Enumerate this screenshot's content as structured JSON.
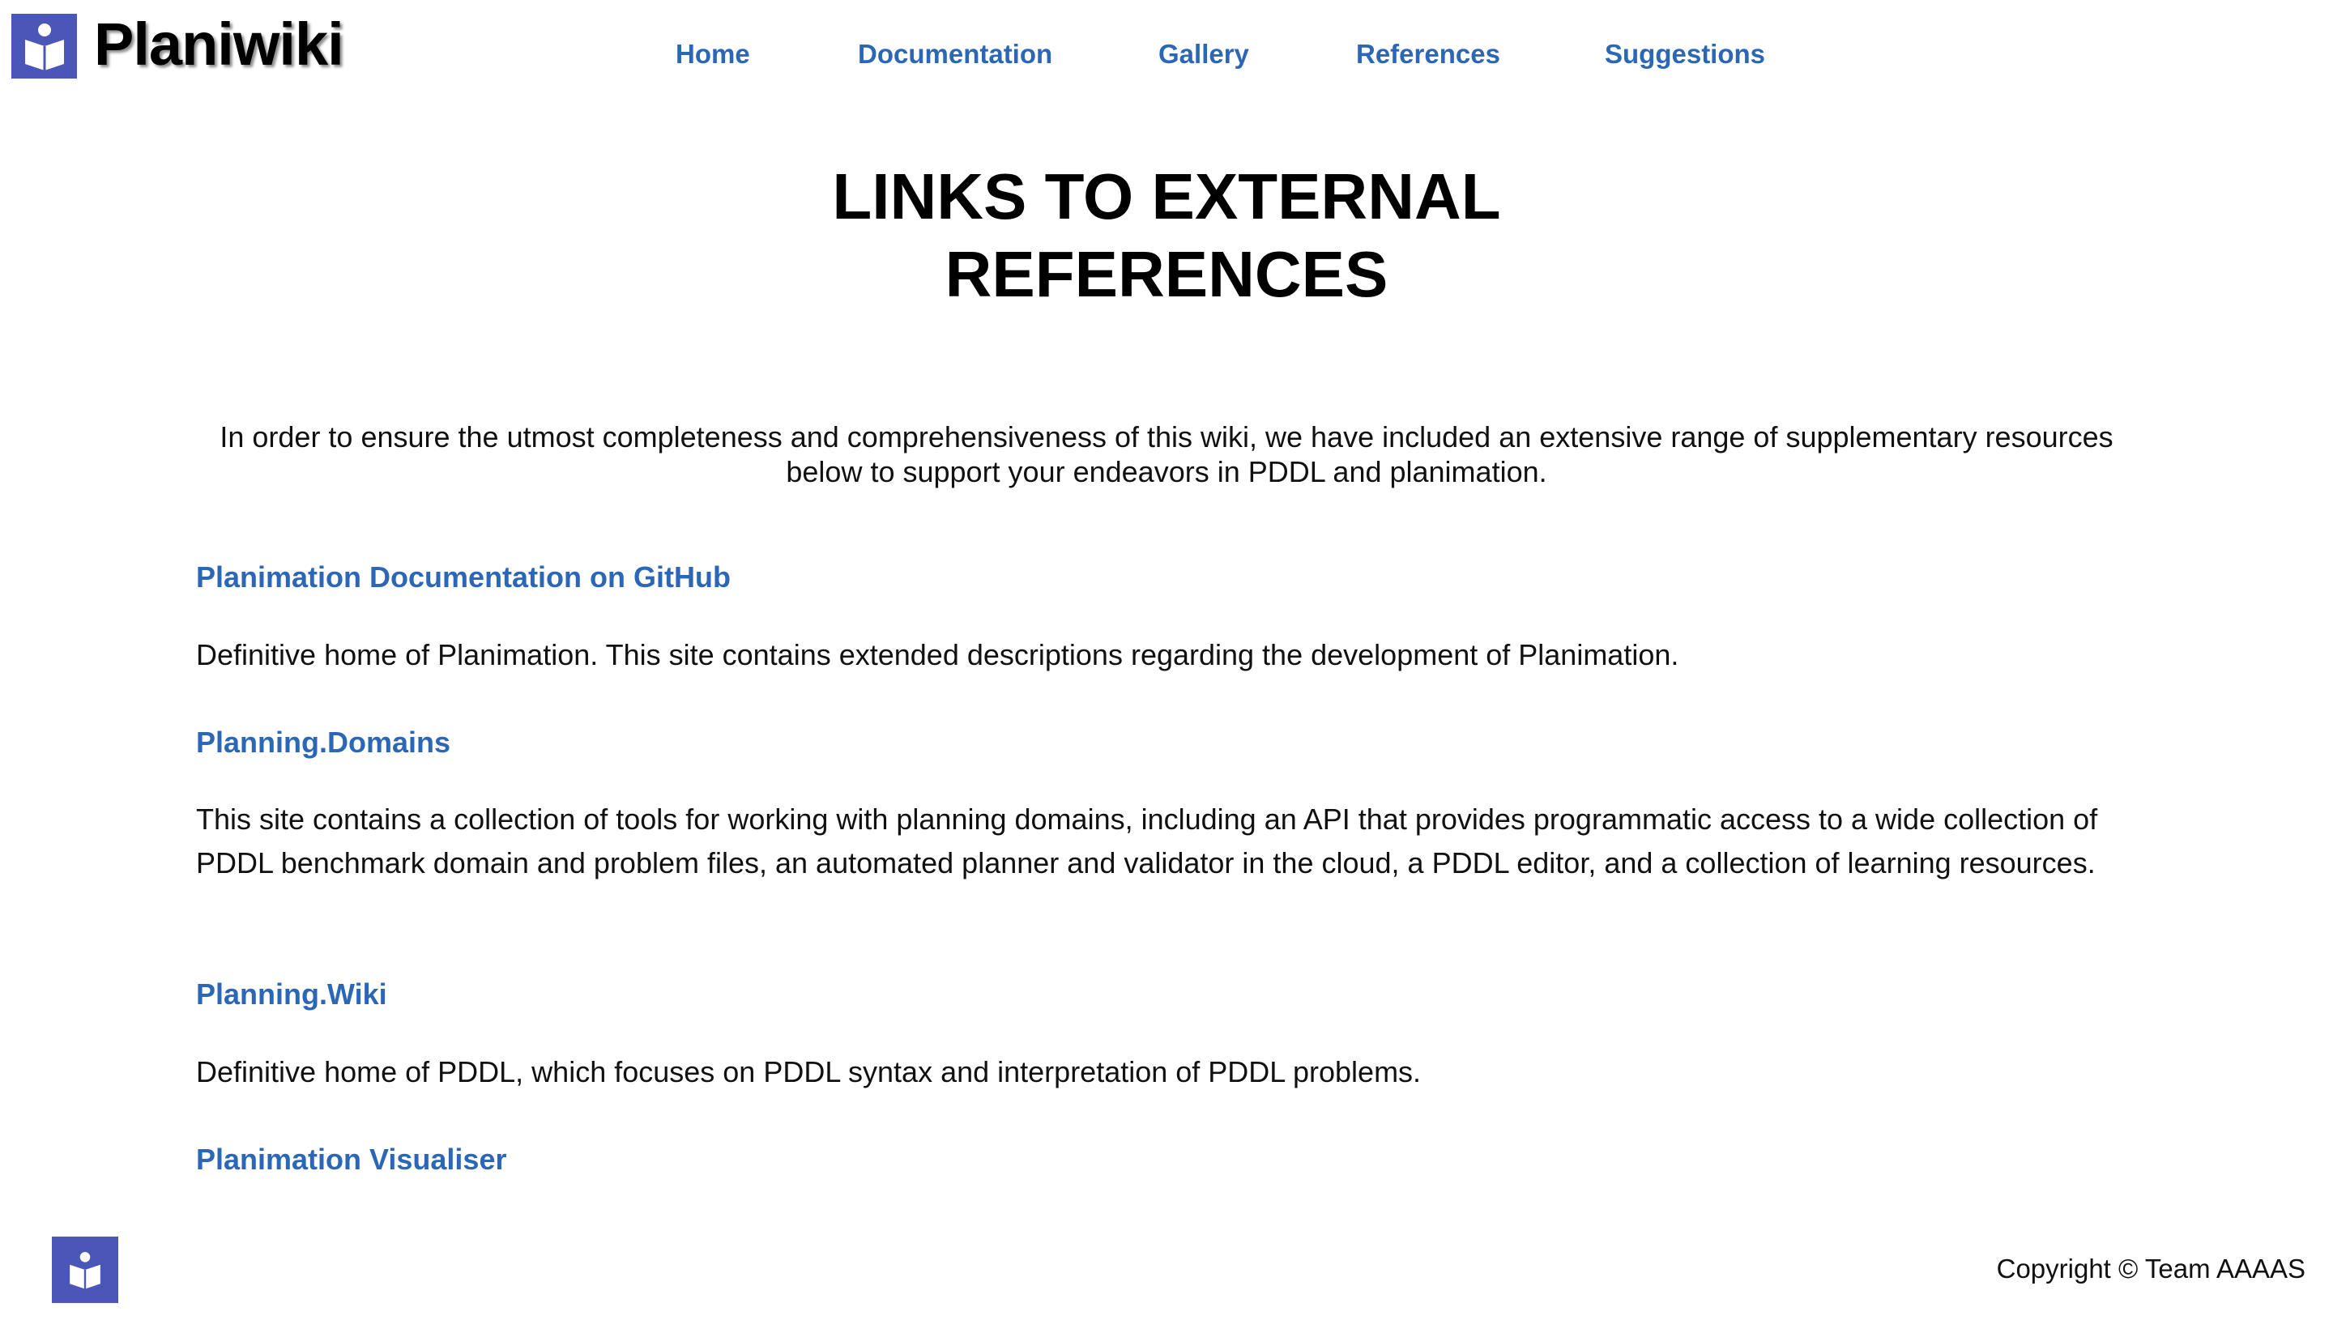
{
  "header": {
    "logo_text": "Planiwiki",
    "logo_icon": "book-person-icon",
    "brand_color": "#4a56b8"
  },
  "nav": {
    "items": [
      {
        "label": "Home"
      },
      {
        "label": "Documentation"
      },
      {
        "label": "Gallery"
      },
      {
        "label": "References"
      },
      {
        "label": "Suggestions"
      }
    ],
    "link_color": "#2c67b6"
  },
  "main": {
    "title_line1": "LINKS TO EXTERNAL",
    "title_line2": "REFERENCES",
    "intro": "In order to ensure the utmost completeness and comprehensiveness of this wiki, we have included an extensive range of supplementary resources below to support your endeavors in PDDL and planimation.",
    "references": [
      {
        "title": "Planimation Documentation on GitHub",
        "description": "Definitive home of Planimation. This site contains extended descriptions regarding the development of Planimation."
      },
      {
        "title": "Planning.Domains",
        "description": "This site contains a collection of tools for working with planning domains, including an API that provides programmatic access to a wide collection of PDDL benchmark domain and problem files, an automated planner and validator in the cloud, a PDDL editor, and a collection of learning resources."
      },
      {
        "title": "Planning.Wiki",
        "description": "Definitive home of PDDL, which focuses on PDDL syntax and interpretation of PDDL problems."
      },
      {
        "title": "Planimation Visualiser",
        "description": ""
      }
    ]
  },
  "footer": {
    "logo_icon": "book-person-icon",
    "copyright": "Copyright © Team AAAAS"
  }
}
